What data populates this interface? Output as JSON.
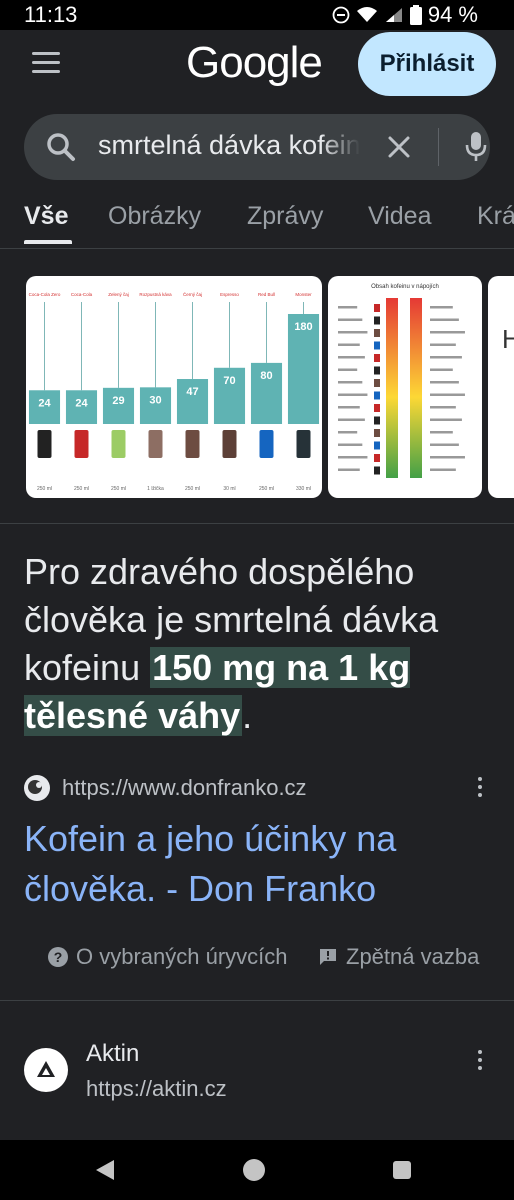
{
  "status_bar": {
    "time": "11:13",
    "battery": "94 %"
  },
  "header": {
    "logo": "Google",
    "login_label": "Přihlásit"
  },
  "search": {
    "query": "smrtelná dávka kofeinu"
  },
  "tabs": [
    {
      "label": "Vše",
      "active": true
    },
    {
      "label": "Obrázky"
    },
    {
      "label": "Zprávy"
    },
    {
      "label": "Videa"
    },
    {
      "label": "Krá"
    }
  ],
  "image_results": {
    "chart_drinks": [
      "Coca-Cola Zero",
      "Coca-Cola",
      "Zelený čaj",
      "Rozpustná káva",
      "Černý čaj",
      "Espresso",
      "Red Bull",
      "Monster"
    ],
    "chart_values": [
      "24",
      "24",
      "29",
      "30",
      "47",
      "70",
      "80",
      "180"
    ],
    "chart_volumes": [
      "250 ml",
      "250 ml",
      "250 ml",
      "1 lžička",
      "250 ml",
      "30 ml",
      "250 ml",
      "330 ml"
    ],
    "second_image_title": "Obsah kofeinu v nápojích",
    "third_image_letter": "H"
  },
  "featured_snippet": {
    "text_before": "Pro zdravého dospělého člověka je smrtelná dávka kofeinu ",
    "highlight": "150 mg na 1 kg tělesné váhy",
    "text_after": "."
  },
  "source": {
    "url": "https://www.donfranko.cz",
    "title": "Kofein a jeho účinky na člověka. - Don Franko"
  },
  "footer": {
    "about_label": "O vybraných úryvcích",
    "feedback_label": "Zpětná vazba"
  },
  "result2": {
    "name": "Aktin",
    "url": "https://aktin.cz"
  },
  "colors": {
    "background": "#202124",
    "link": "#8ab4f8",
    "highlight_bg": "#344d47",
    "login_bg": "#c2e7ff"
  }
}
